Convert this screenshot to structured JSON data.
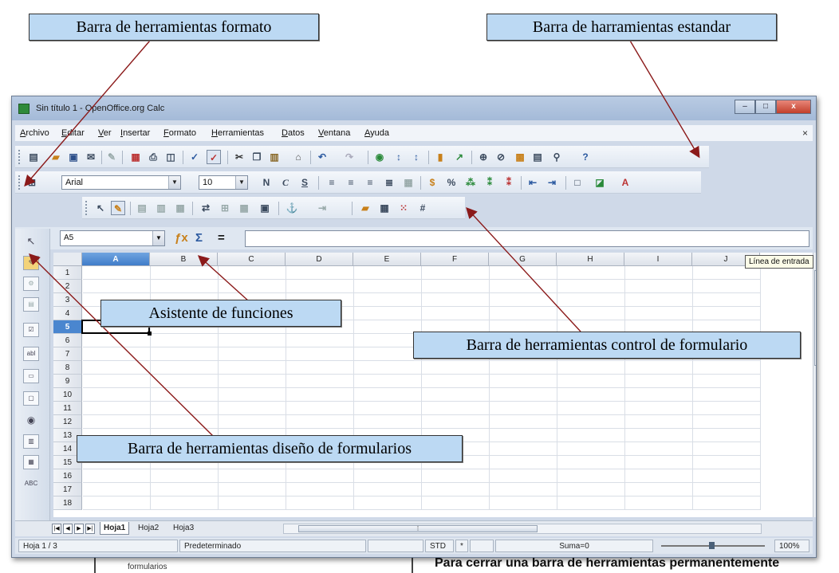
{
  "window": {
    "title": "Sin título 1 - OpenOffice.org Calc",
    "close_doc": "×",
    "controls": {
      "minimize": "–",
      "maximize": "□",
      "close": "x"
    }
  },
  "menu": [
    "Archivo",
    "Editar",
    "Ver",
    "Insertar",
    "Formato",
    "Herramientas",
    "Datos",
    "Ventana",
    "Ayuda"
  ],
  "format_toolbar": {
    "font_name": "Arial",
    "font_size": "10",
    "bold": "N",
    "italic": "C",
    "underline": "S"
  },
  "formula_bar": {
    "name_box": "A5",
    "function_wizard": "ƒx",
    "sum": "Σ",
    "equals": "=",
    "input_value": ""
  },
  "tooltip": "Línea de entrada",
  "columns": [
    "A",
    "B",
    "C",
    "D",
    "E",
    "F",
    "G",
    "H",
    "I",
    "J"
  ],
  "rows": [
    "1",
    "2",
    "3",
    "4",
    "5",
    "6",
    "7",
    "8",
    "9",
    "10",
    "11",
    "12",
    "13",
    "14",
    "15",
    "16",
    "17",
    "18"
  ],
  "selected_cell": {
    "column": "A",
    "row": "5"
  },
  "sheet_tabs": [
    "Hoja1",
    "Hoja2",
    "Hoja3"
  ],
  "status_bar": {
    "sheet": "Hoja 1 / 3",
    "page_style": "Predeterminado",
    "mode": "STD",
    "modified": "*",
    "sum": "Suma=0",
    "zoom": "100%"
  },
  "callouts": {
    "format_toolbar": "Barra de herramientas formato",
    "standard_toolbar": "Barra de harramientas estandar",
    "function_wizard": "Asistente de funciones",
    "form_controls": "Barra de herramientas control de formulario",
    "form_design": "Barra de herramientas diseño de formularios"
  },
  "background_text": {
    "main": "Para cerrar una barra de herramientas permanentemente",
    "small": "formularios"
  },
  "colors": {
    "callout_fill": "#bcd9f3",
    "arrow": "#8b1a1a",
    "selection": "#4a86cf"
  }
}
